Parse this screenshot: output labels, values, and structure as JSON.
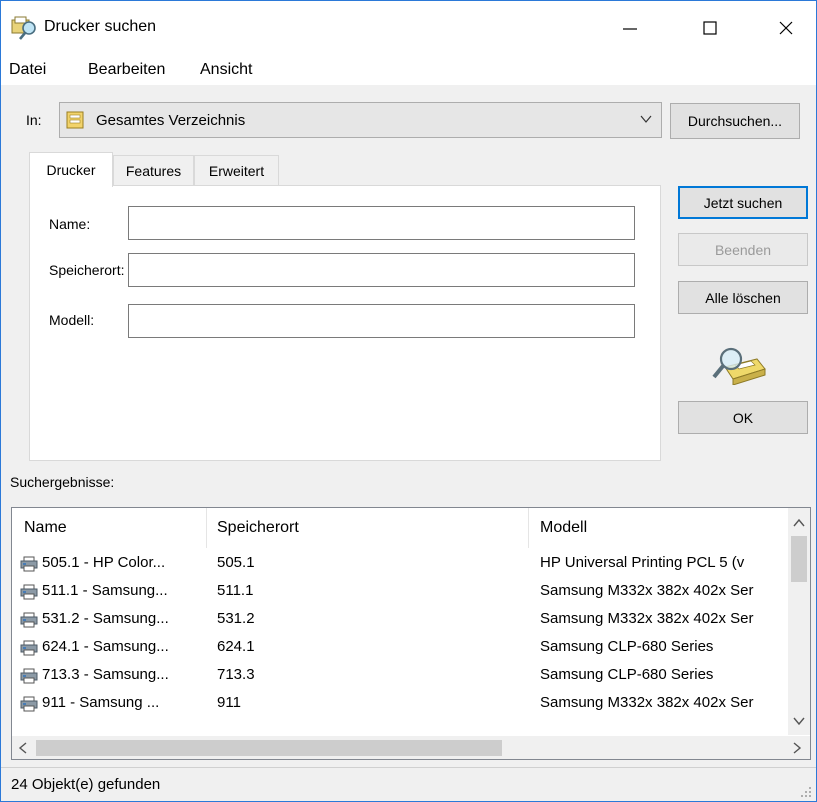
{
  "window": {
    "title": "Drucker suchen",
    "controls": {
      "minimize": "—",
      "maximize": "☐",
      "close": "✕"
    }
  },
  "menu": {
    "items": [
      "Datei",
      "Bearbeiten",
      "Ansicht"
    ]
  },
  "scope": {
    "label": "In:",
    "value": "Gesamtes Verzeichnis",
    "browse_label": "Durchsuchen..."
  },
  "tabs": [
    {
      "label": "Drucker",
      "active": true
    },
    {
      "label": "Features",
      "active": false
    },
    {
      "label": "Erweitert",
      "active": false
    }
  ],
  "form": {
    "fields": [
      {
        "label": "Name:",
        "value": ""
      },
      {
        "label": "Speicherort:",
        "value": ""
      },
      {
        "label": "Modell:",
        "value": ""
      }
    ]
  },
  "actions": {
    "search_now": "Jetzt suchen",
    "stop": "Beenden",
    "clear_all": "Alle löschen",
    "ok": "OK"
  },
  "results": {
    "label": "Suchergebnisse:",
    "columns": [
      "Name",
      "Speicherort",
      "Modell"
    ],
    "rows": [
      [
        "505.1 - HP Color...",
        "505.1",
        "HP Universal Printing PCL 5 (v"
      ],
      [
        "511.1 - Samsung...",
        "511.1",
        "Samsung M332x 382x 402x Ser"
      ],
      [
        "531.2 - Samsung...",
        "531.2",
        "Samsung M332x 382x 402x Ser"
      ],
      [
        "624.1 - Samsung...",
        "624.1",
        "Samsung CLP-680 Series"
      ],
      [
        "713.3 - Samsung...",
        "713.3",
        "Samsung CLP-680 Series"
      ],
      [
        "911 - Samsung ...",
        "911",
        "Samsung M332x 382x 402x Ser"
      ]
    ]
  },
  "status": {
    "text": "24 Objekt(e) gefunden"
  },
  "icons": {
    "app": "printer-search-icon",
    "scope": "directory-icon",
    "row": "printer-icon",
    "search_graphic": "magnifier-printer-icon"
  },
  "colors": {
    "accent": "#0078d7",
    "window_border": "#2b79d8",
    "disabled_text": "#9a9a9a"
  }
}
